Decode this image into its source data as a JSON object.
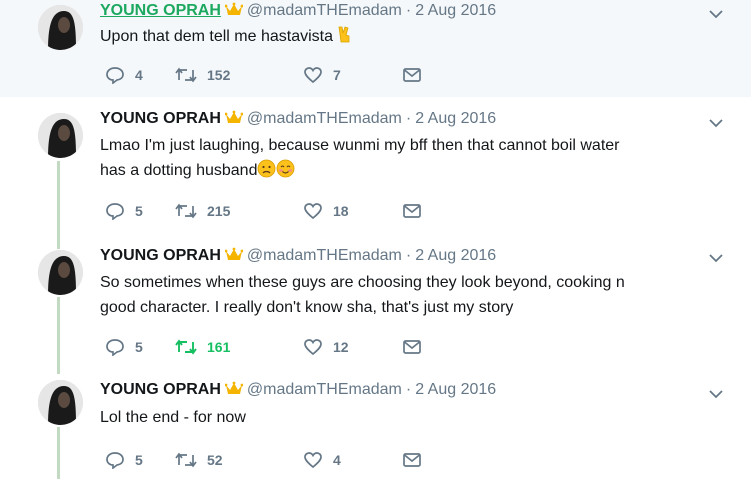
{
  "tweets": [
    {
      "name": "YOUNG OPRAH",
      "handle": "@madamTHEmadam",
      "separator": "·",
      "date": "2 Aug 2016",
      "text": "Upon that dem tell me hastavista",
      "emojis": [
        "victory-hand"
      ],
      "replies": "4",
      "retweets": "152",
      "likes": "7",
      "retweeted": false
    },
    {
      "name": "YOUNG OPRAH",
      "handle": "@madamTHEmadam",
      "separator": "·",
      "date": "2 Aug 2016",
      "text_line1": "Lmao I'm just laughing, because wunmi my bff then that cannot boil water",
      "text_line2": "has a dotting husband",
      "emojis": [
        "worried-face",
        "smiling-face"
      ],
      "replies": "5",
      "retweets": "215",
      "likes": "18",
      "retweeted": false
    },
    {
      "name": "YOUNG OPRAH",
      "handle": "@madamTHEmadam",
      "separator": "·",
      "date": "2 Aug 2016",
      "text_line1": "So sometimes when these guys are choosing they look beyond, cooking n",
      "text_line2": "good character. I really don't know sha, that's just my story",
      "replies": "5",
      "retweets": "161",
      "likes": "12",
      "retweeted": true
    },
    {
      "name": "YOUNG OPRAH",
      "handle": "@madamTHEmadam",
      "separator": "·",
      "date": "2 Aug 2016",
      "text": "Lol the end - for now",
      "replies": "5",
      "retweets": "52",
      "likes": "4",
      "retweeted": false
    }
  ],
  "colors": {
    "name_highlight": "#1da85f",
    "retweeted_green": "#17bf63",
    "muted": "#657786",
    "thread_line": "#c2d9c2",
    "hover_bg": "#f5f8fa"
  }
}
